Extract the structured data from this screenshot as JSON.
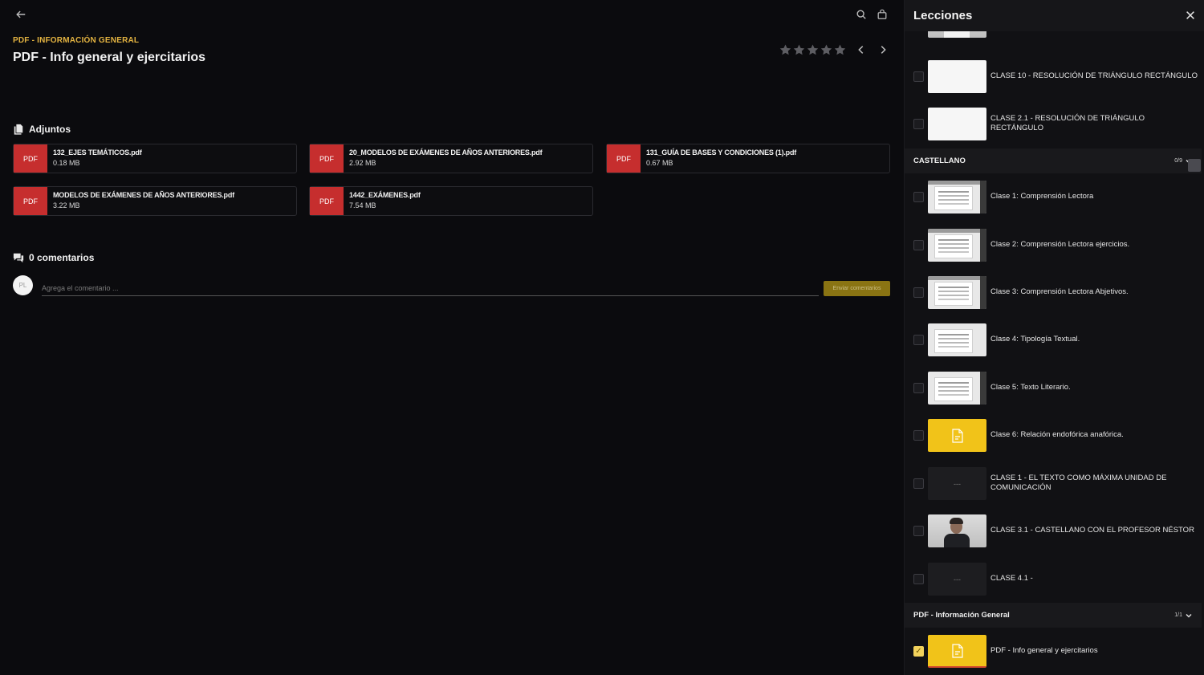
{
  "header": {
    "breadcrumb": "PDF - INFORMACIÓN GENERAL",
    "title": "PDF - Info general y ejercitarios",
    "rating": {
      "value": 0,
      "max": 5
    }
  },
  "attachments": {
    "label": "Adjuntos",
    "files": [
      {
        "type": "PDF",
        "name": "132_EJES TEMÁTICOS.pdf",
        "size": "0.18 MB"
      },
      {
        "type": "PDF",
        "name": "20_MODELOS DE EXÁMENES DE AÑOS ANTERIORES.pdf",
        "size": "2.92 MB"
      },
      {
        "type": "PDF",
        "name": "131_GUÍA DE BASES Y CONDICIONES (1).pdf",
        "size": "0.67 MB"
      },
      {
        "type": "PDF",
        "name": "MODELOS DE EXÁMENES DE AÑOS ANTERIORES.pdf",
        "size": "3.22 MB"
      },
      {
        "type": "PDF",
        "name": "1442_EXÁMENES.pdf",
        "size": "7.54 MB"
      }
    ]
  },
  "comments": {
    "label": "0 comentarios",
    "avatar_initials": "PL",
    "placeholder": "Agrega el comentario ...",
    "send_label": "Enviar comentarios"
  },
  "sidebar": {
    "title": "Lecciones",
    "lessons_top": [
      {
        "label": "CLASE 10 - RESOLUCIÓN DE TRIÁNGULO RECTÁNGULO",
        "thumb": "white"
      },
      {
        "label": "CLASE 2.1 - RESOLUCIÓN DE TRIÁNGULO RECTÁNGULO",
        "thumb": "white"
      }
    ],
    "groups": [
      {
        "name": "CASTELLANO",
        "count": "0/9",
        "lessons": [
          {
            "label": "Clase 1: Comprensión Lectora",
            "thumb": "doc"
          },
          {
            "label": "Clase 2: Comprensión Lectora ejercicios.",
            "thumb": "doc"
          },
          {
            "label": "Clase 3: Comprensión Lectora Abjetivos.",
            "thumb": "doc"
          },
          {
            "label": "Clase 4: Tipología Textual.",
            "thumb": "doc"
          },
          {
            "label": "Clase 5: Texto Literario.",
            "thumb": "doc"
          },
          {
            "label": "Clase 6: Relación endofórica anafórica.",
            "thumb": "yellow"
          },
          {
            "label": "CLASE 1 - EL TEXTO COMO MÁXIMA UNIDAD DE COMUNICACIÓN",
            "thumb": "dark",
            "thumb_text": "---"
          },
          {
            "label": "CLASE 3.1 - CASTELLANO CON EL PROFESOR NÉSTOR",
            "thumb": "person"
          },
          {
            "label": "CLASE 4.1 -",
            "thumb": "dark",
            "thumb_text": "---"
          }
        ]
      },
      {
        "name": "PDF - Información General",
        "count": "1/1",
        "lessons": [
          {
            "label": "PDF - Info general y ejercitarios",
            "thumb": "yellow",
            "checked": true
          }
        ]
      }
    ]
  },
  "colors": {
    "accent": "#e3b341",
    "pdf_badge": "#c62e2e",
    "doc_thumb": "#f1c319",
    "send_button": "#8a7413"
  }
}
